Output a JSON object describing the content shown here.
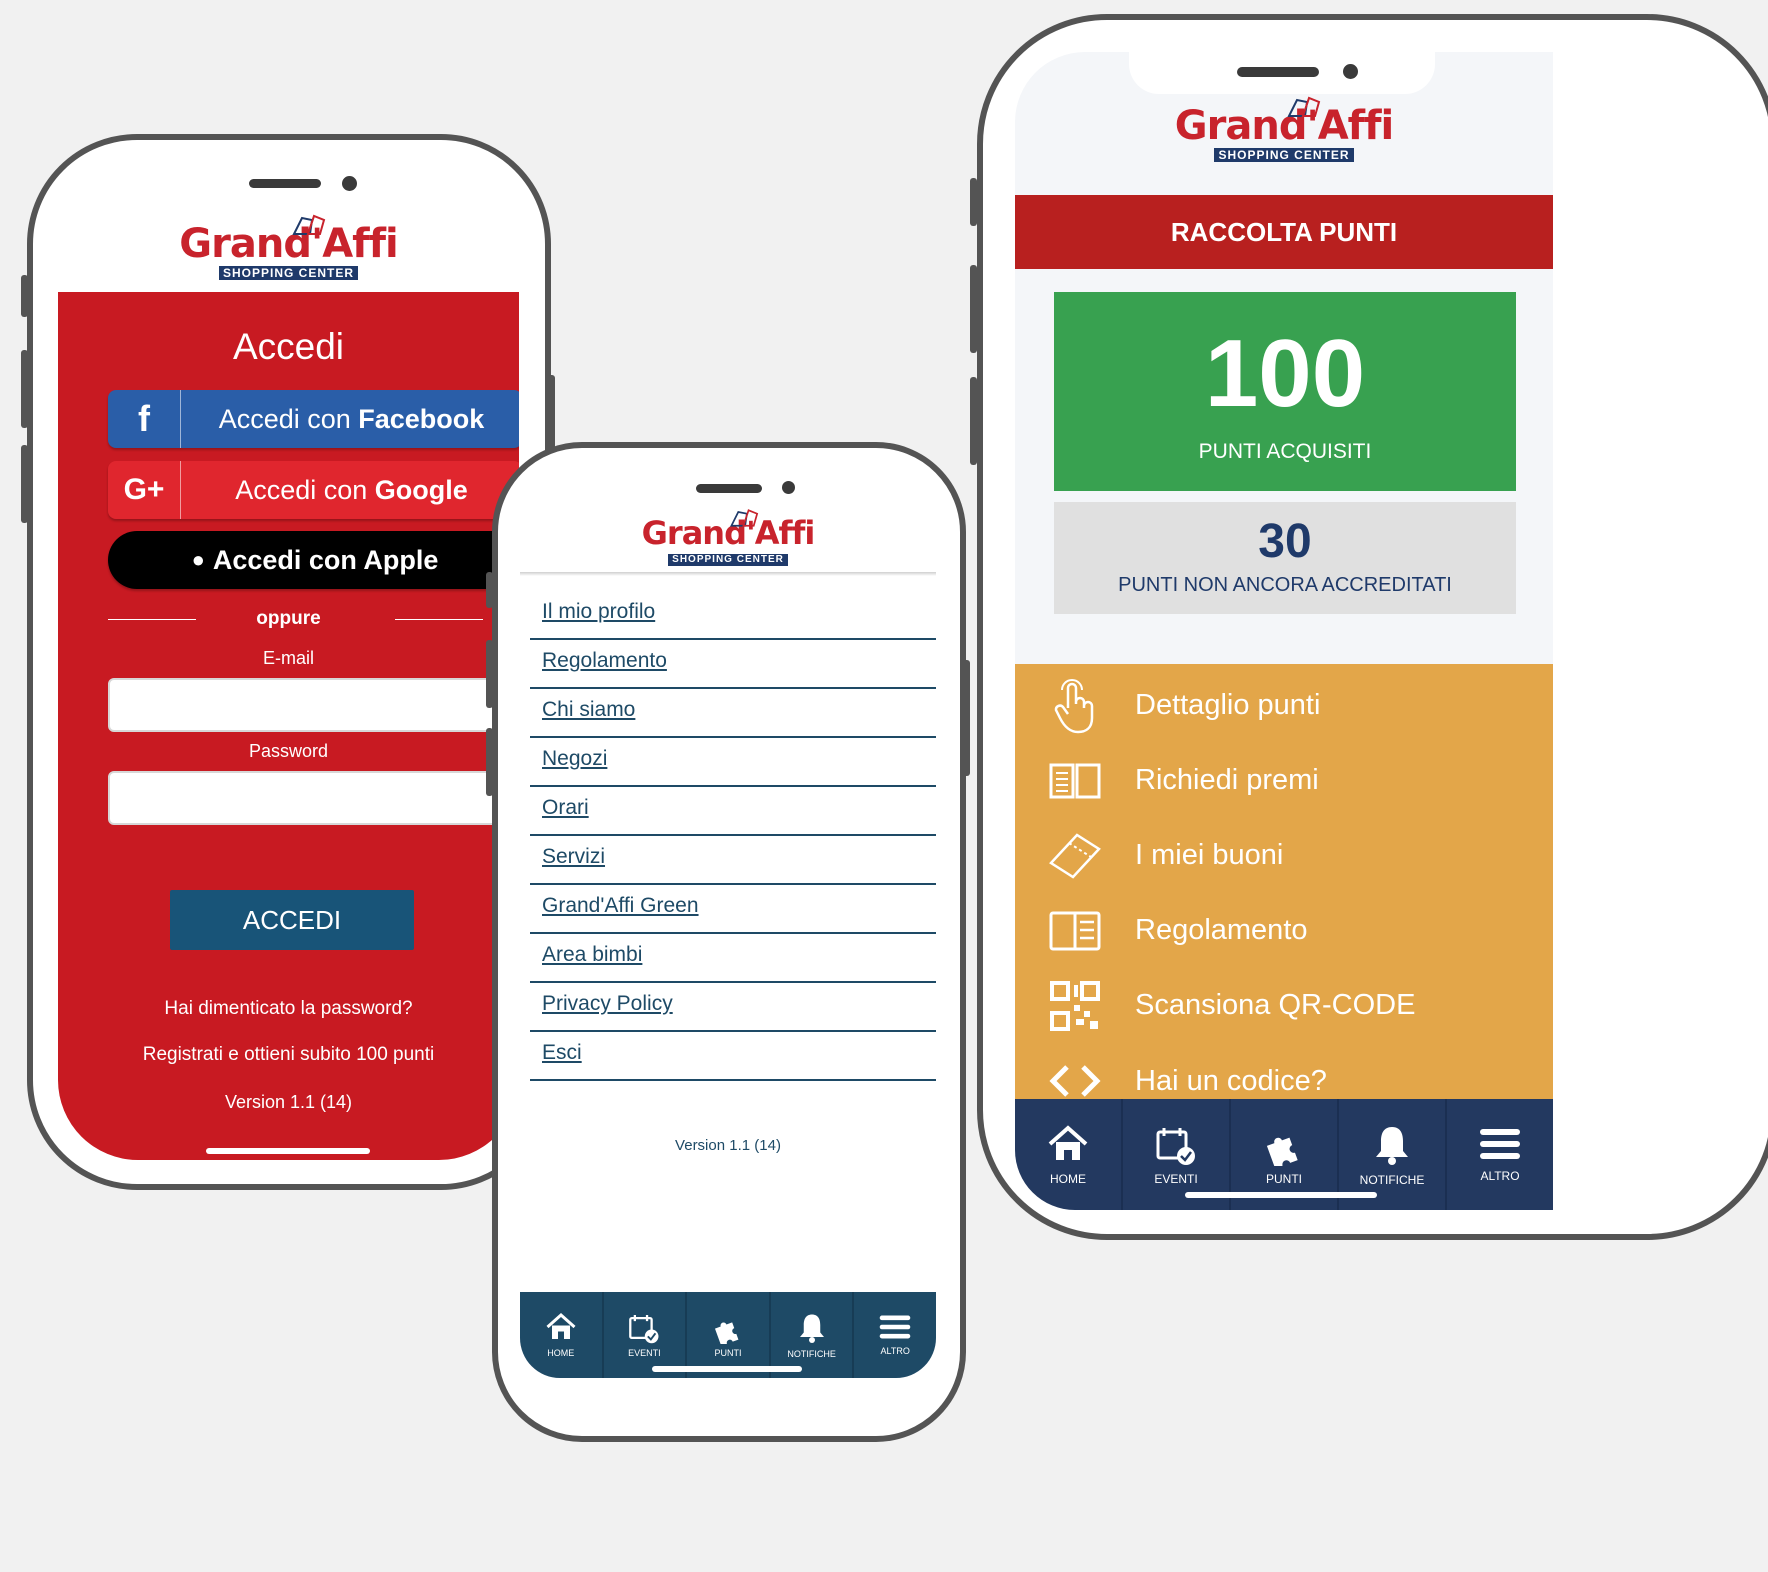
{
  "brand": {
    "name": "Grand'Affi",
    "tagline": "SHOPPING CENTER",
    "color": "#c8232c",
    "tagline_bg": "#1f3a6a"
  },
  "login": {
    "title": "Accedi",
    "facebook": {
      "prefix": "Accedi con ",
      "bold": "Facebook",
      "icon": "facebook-icon",
      "color": "#2a5ea8"
    },
    "google": {
      "prefix": "Accedi con ",
      "bold": "Google",
      "icon": "google-plus-icon",
      "color": "#e0262e"
    },
    "apple": {
      "label": "Accedi con Apple",
      "icon": "apple-icon"
    },
    "divider": "oppure",
    "email_label": "E-mail",
    "email_value": "",
    "password_label": "Password",
    "password_value": "",
    "submit": "ACCEDI",
    "forgot": "Hai dimenticato la password?",
    "register": "Registrati e ottieni subito 100 punti",
    "version": "Version 1.1 (14)",
    "panel_color": "#c81a22",
    "submit_color": "#185478"
  },
  "menu": {
    "items": [
      "Il mio profilo",
      "Regolamento",
      "Chi siamo",
      "Negozi",
      "Orari",
      "Servizi",
      "Grand'Affi Green",
      "Area bimbi",
      "Privacy Policy",
      "Esci"
    ],
    "version": "Version 1.1 (14)",
    "link_color": "#1e4a66"
  },
  "tabs": [
    {
      "label": "HOME",
      "icon": "home-icon"
    },
    {
      "label": "EVENTI",
      "icon": "calendar-check-icon"
    },
    {
      "label": "PUNTI",
      "icon": "puzzle-icon"
    },
    {
      "label": "NOTIFICHE",
      "icon": "bell-icon"
    },
    {
      "label": "ALTRO",
      "icon": "hamburger-menu-icon"
    }
  ],
  "points": {
    "header": "RACCOLTA PUNTI",
    "acquired_value": "100",
    "acquired_label": "PUNTI ACQUISITI",
    "pending_value": "30",
    "pending_label": "PUNTI NON ANCORA ACCREDITATI",
    "header_color": "#b8201f",
    "acquired_color": "#38a150",
    "pending_color": "#e0e0e0",
    "menu_color": "#e3a649",
    "menu": [
      {
        "label": "Dettaglio punti",
        "icon": "tap-hand-icon"
      },
      {
        "label": "Richiedi premi",
        "icon": "open-book-icon"
      },
      {
        "label": "I miei buoni",
        "icon": "ticket-icon"
      },
      {
        "label": "Regolamento",
        "icon": "document-icon"
      },
      {
        "label": "Scansiona QR-CODE",
        "icon": "qr-code-icon"
      },
      {
        "label": "Hai un codice?",
        "icon": "code-brackets-icon"
      }
    ],
    "tabbar_color": "#233960"
  }
}
